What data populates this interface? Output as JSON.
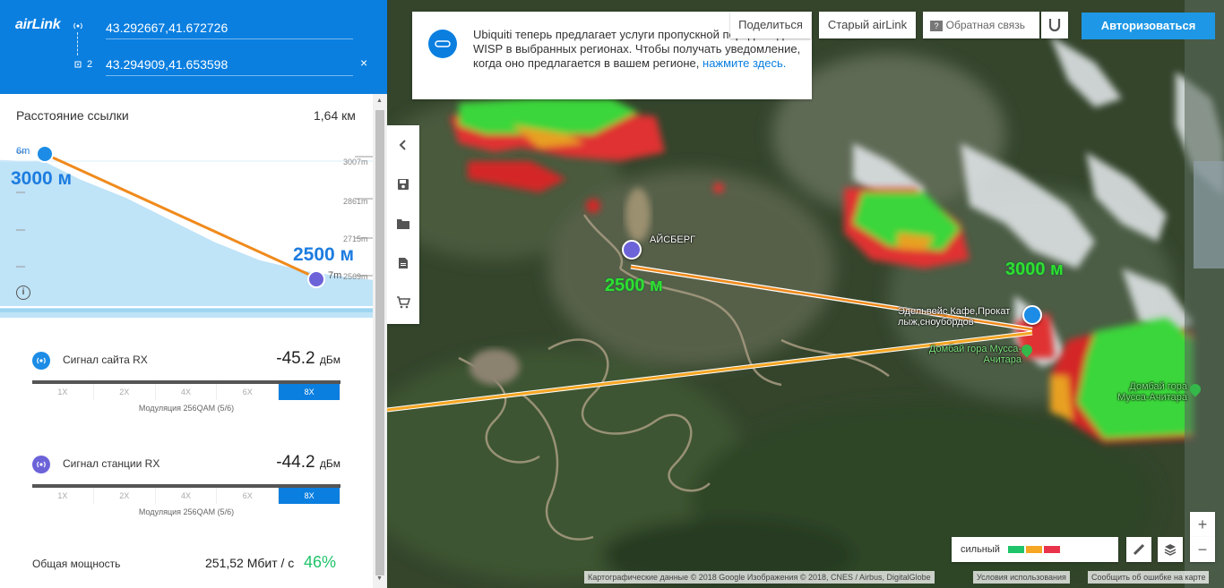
{
  "header": {
    "logo": "airLink",
    "coord1": "43.292667,41.672726",
    "coord2": "43.294909,41.653598",
    "station_index": "2",
    "close_icon": "×"
  },
  "link": {
    "distance_label": "Расстояние ссылки",
    "distance_value": "1,64 км"
  },
  "profile": {
    "left_height_small": "6m",
    "left_elevation": "3000 м",
    "right_height_small": "7m",
    "right_elevation": "2500 м",
    "ticks": [
      "3007m",
      "2861m",
      "2715m",
      "2569m"
    ]
  },
  "site_signal": {
    "label": "Сигнал сайта RX",
    "value": "-45.2",
    "unit": "дБм",
    "modulation_levels": [
      "1X",
      "2X",
      "4X",
      "6X",
      "8X"
    ],
    "active_level": "8X",
    "modulation_text": "Модуляция 256QAM (5/6)"
  },
  "station_signal": {
    "label": "Сигнал станции RX",
    "value": "-44.2",
    "unit": "дБм",
    "modulation_levels": [
      "1X",
      "2X",
      "4X",
      "6X",
      "8X"
    ],
    "active_level": "8X",
    "modulation_text": "Модуляция 256QAM (5/6)"
  },
  "total": {
    "label": "Общая мощность",
    "value": "251,52 Мбит / с",
    "percent": "46%"
  },
  "notice": {
    "text": "Ubiquiti теперь предлагает услуги пропускной передачи для WISP в выбранных регионах. Чтобы получать уведомление, когда оно предлагается в вашем регионе,",
    "link": "нажмите здесь."
  },
  "topbar": {
    "share": "Поделиться",
    "old_airlink": "Старый airLink",
    "feedback": "Обратная связь",
    "login": "Авторизоваться"
  },
  "map": {
    "label_aysberg": "АЙСБЕРГ",
    "label_cafe": "Эдельвейс Кафе,Прокат лыж,сноубордов",
    "label_dombay1": "Домбай гора Мусса-Ачитара",
    "label_dombay2": "Домбай гора Мусса-Ачитара",
    "elev_station": "2500 м",
    "elev_site": "3000 м"
  },
  "legend": {
    "label": "сильный",
    "colors": [
      "#1fc46a",
      "#f5a623",
      "#e8334a"
    ]
  },
  "attribution": {
    "data": "Картографические данные © 2018 Google Изображения © 2018, CNES / Airbus, DigitalGlobe",
    "terms": "Условия использования",
    "report": "Сообщить об ошибке на карте"
  },
  "colors": {
    "brand_blue": "#0a7fe0",
    "link_orange": "#f08a1c",
    "station_purple": "#6c63d8"
  }
}
